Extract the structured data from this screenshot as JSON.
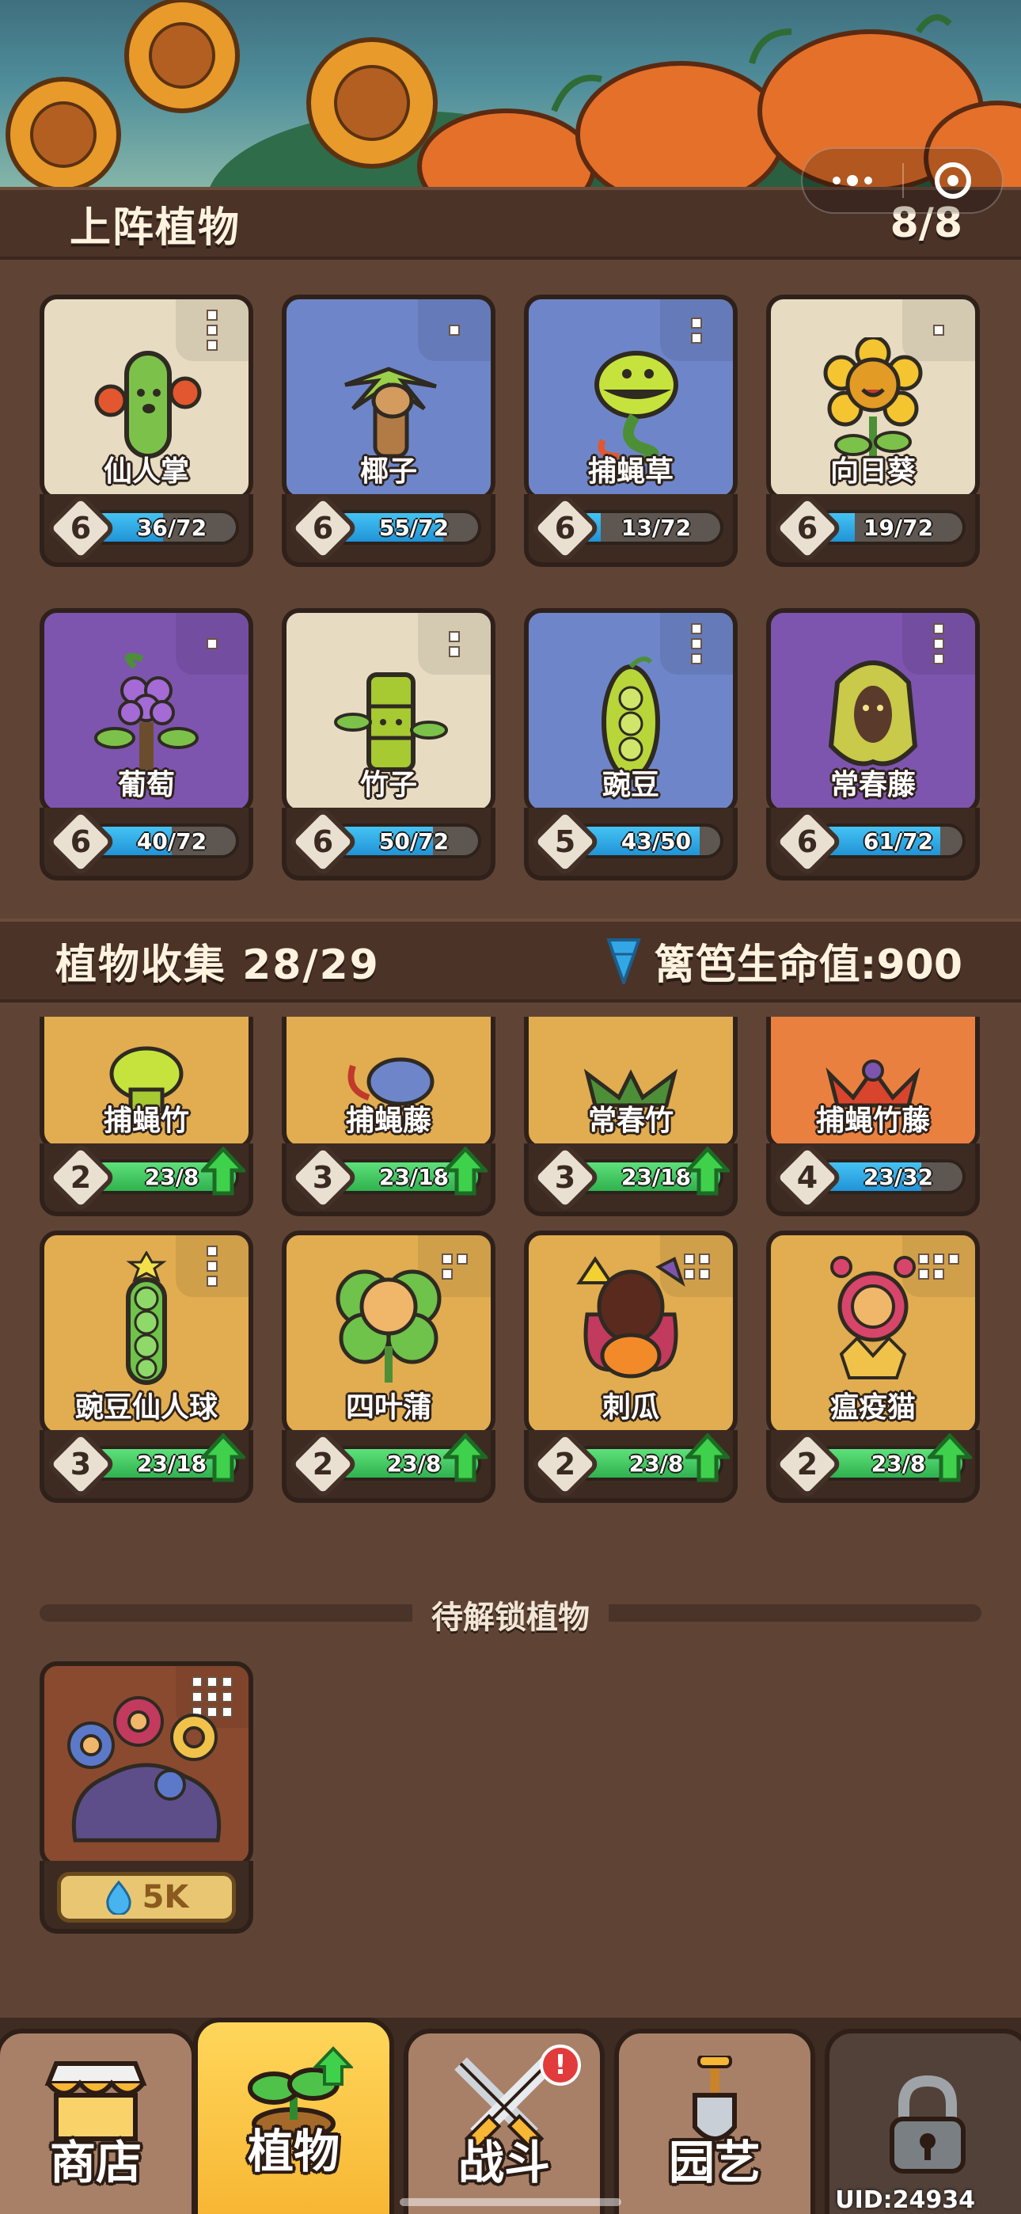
{
  "lineup": {
    "title": "上阵植物",
    "count": "8/8",
    "plants": [
      {
        "name": "仙人掌",
        "level": "6",
        "progress": "36/72",
        "ratio": 0.5,
        "bg": "#e7dcc2"
      },
      {
        "name": "椰子",
        "level": "6",
        "progress": "55/72",
        "ratio": 0.76,
        "bg": "#6e86c9"
      },
      {
        "name": "捕蝇草",
        "level": "6",
        "progress": "13/72",
        "ratio": 0.18,
        "bg": "#6e86c9"
      },
      {
        "name": "向日葵",
        "level": "6",
        "progress": "19/72",
        "ratio": 0.26,
        "bg": "#e7dcc2"
      },
      {
        "name": "葡萄",
        "level": "6",
        "progress": "40/72",
        "ratio": 0.56,
        "bg": "#7d55ae"
      },
      {
        "name": "竹子",
        "level": "6",
        "progress": "50/72",
        "ratio": 0.69,
        "bg": "#e7dcc2"
      },
      {
        "name": "豌豆",
        "level": "5",
        "progress": "43/50",
        "ratio": 0.86,
        "bg": "#6e86c9"
      },
      {
        "name": "常春藤",
        "level": "6",
        "progress": "61/72",
        "ratio": 0.85,
        "bg": "#7d55ae"
      }
    ]
  },
  "collection": {
    "title": "植物收集 28/29",
    "fence_hp": "篱笆生命值:900",
    "plants": [
      {
        "name": "捕蝇竹",
        "level": "2",
        "progress": "23/8",
        "ratio": 1,
        "upgrade": true
      },
      {
        "name": "捕蝇藤",
        "level": "3",
        "progress": "23/18",
        "ratio": 1,
        "upgrade": true
      },
      {
        "name": "常春竹",
        "level": "3",
        "progress": "23/18",
        "ratio": 1,
        "upgrade": true
      },
      {
        "name": "捕蝇竹藤",
        "level": "4",
        "progress": "23/32",
        "ratio": 0.72,
        "upgrade": false
      },
      {
        "name": "豌豆仙人球",
        "level": "3",
        "progress": "23/18",
        "ratio": 1,
        "upgrade": true
      },
      {
        "name": "四叶蒲",
        "level": "2",
        "progress": "23/8",
        "ratio": 1,
        "upgrade": true
      },
      {
        "name": "刺瓜",
        "level": "2",
        "progress": "23/8",
        "ratio": 1,
        "upgrade": true
      },
      {
        "name": "瘟疫猫",
        "level": "2",
        "progress": "23/8",
        "ratio": 1,
        "upgrade": true
      }
    ]
  },
  "locked": {
    "title": "待解锁植物",
    "price": "5K"
  },
  "tabs": [
    {
      "label": "商店"
    },
    {
      "label": "植物"
    },
    {
      "label": "战斗",
      "badge": "!"
    },
    {
      "label": "园艺"
    }
  ],
  "uid": "UID:24934"
}
